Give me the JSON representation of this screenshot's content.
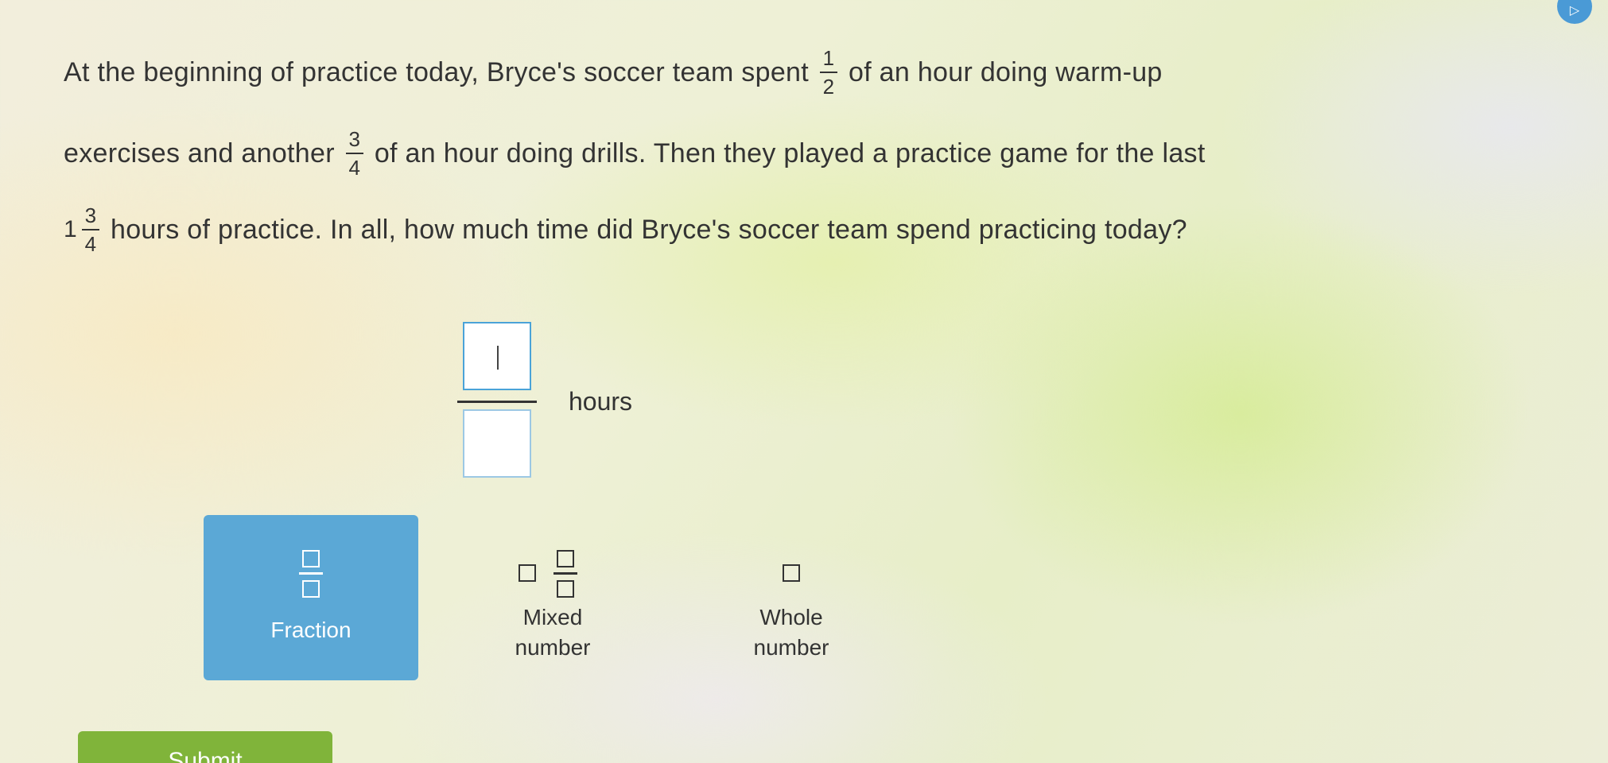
{
  "question": {
    "line1_a": "At the beginning of practice today, Bryce's soccer team spent",
    "frac1": {
      "num": "1",
      "den": "2"
    },
    "line1_b": "of an hour doing warm-up",
    "line2_a": "exercises and another",
    "frac2": {
      "num": "3",
      "den": "4"
    },
    "line2_b": "of an hour doing drills. Then they played a practice game for the last",
    "mixed3": {
      "whole": "1",
      "num": "3",
      "den": "4"
    },
    "line3_b": "hours of practice. In all, how much time did Bryce's soccer team spend practicing today?"
  },
  "answer": {
    "numerator_value": "",
    "denominator_value": "",
    "unit": "hours"
  },
  "choices": {
    "fraction_label": "Fraction",
    "mixed_label_1": "Mixed",
    "mixed_label_2": "number",
    "whole_label_1": "Whole",
    "whole_label_2": "number",
    "selected": "Fraction"
  },
  "submit_label": "Submit",
  "colors": {
    "accent": "#5ba8d6",
    "submit": "#80b43a",
    "text": "#333333"
  }
}
